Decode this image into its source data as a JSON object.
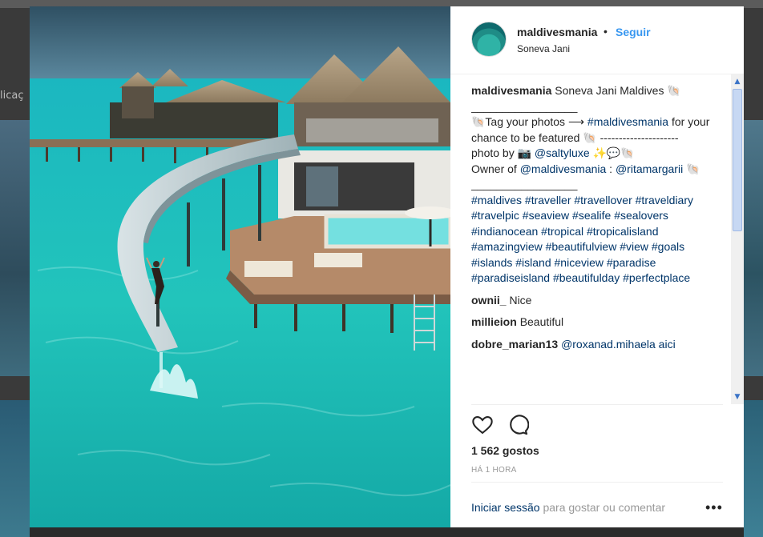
{
  "background": {
    "left_text": "licaç"
  },
  "post": {
    "username": "maldivesmania",
    "separator": "•",
    "follow_label": "Seguir",
    "location": "Soneva Jani"
  },
  "caption": {
    "username": "maldivesmania",
    "title": "Soneva Jani Maldives 🐚",
    "rule": "_________________",
    "tag_line_prefix": "🐚Tag your photos ⟶ ",
    "tag_line_tag": "#maldivesmania",
    "tag_line_suffix": " for your chance to be featured 🐚 ---------------------",
    "photo_by_prefix": "photo by 📷 ",
    "photo_by_handle": "@saltyluxe",
    "photo_by_suffix": " ✨💬🐚",
    "owner_prefix": "Owner of ",
    "owner_handle": "@maldivesmania",
    "owner_sep": " : ",
    "owner_handle2": "@ritamargarii",
    "owner_suffix": " 🐚",
    "rule2": "_________________",
    "hashtags": "#maldives #traveller #travellover #traveldiary #travelpic #seaview #sealife #sealovers #indianocean #tropical #tropicalisland #amazingview #beautifulview #view #goals #islands #island #niceview #paradise #paradiseisland #beautifulday #perfectplace"
  },
  "comments": [
    {
      "user": "ownii_",
      "text": "Nice"
    },
    {
      "user": "millieion",
      "text": "Beautiful"
    },
    {
      "user": "dobre_marian13",
      "text": "@roxanad.mihaela aici"
    }
  ],
  "actions": {
    "like_icon": "heart-icon",
    "comment_icon": "comment-icon"
  },
  "likes": "1 562 gostos",
  "timestamp": "HÁ 1 HORA",
  "login": {
    "link": "Iniciar sessão",
    "rest": " para gostar ou comentar"
  },
  "more_label": "•••",
  "colors": {
    "link": "#003569",
    "follow": "#3897f0",
    "text": "#262626",
    "muted": "#999999"
  }
}
